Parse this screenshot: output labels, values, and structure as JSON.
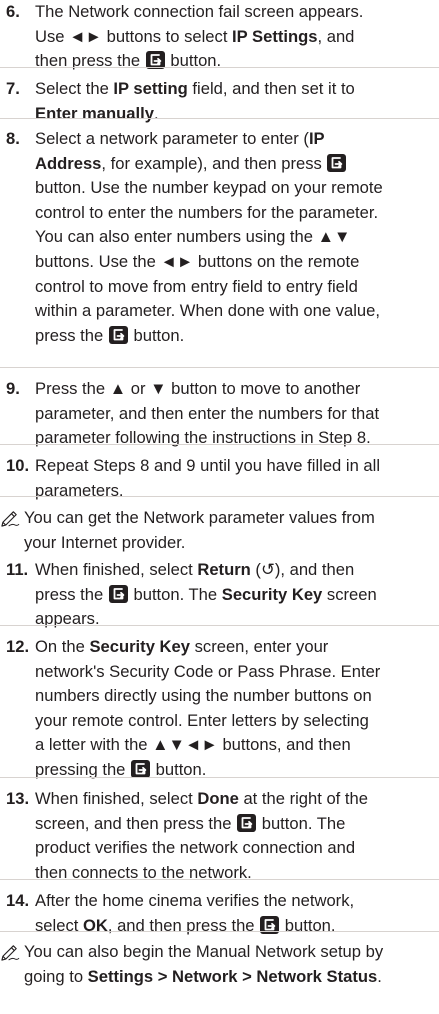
{
  "steps": [
    {
      "num": "6.",
      "lines": [
        [
          {
            "t": "The Network connection fail screen appears."
          }
        ],
        [
          {
            "t": "Use "
          },
          {
            "t": "◄►"
          },
          {
            "t": " buttons to select "
          },
          {
            "t": "IP Settings",
            "b": 1
          },
          {
            "t": ", and"
          }
        ],
        [
          {
            "t": "then press the "
          },
          {
            "i": "enter-icon"
          },
          {
            "t": " button."
          }
        ]
      ]
    },
    {
      "num": "7.",
      "lines": [
        [
          {
            "t": "Select the "
          },
          {
            "t": "IP setting",
            "b": 1
          },
          {
            "t": " field, and then set it to"
          }
        ],
        [
          {
            "t": "Enter manually",
            "b": 1
          },
          {
            "t": "."
          }
        ]
      ]
    },
    {
      "num": "8.",
      "lines": [
        [
          {
            "t": "Select a network parameter to enter ("
          },
          {
            "t": "IP",
            "b": 1
          }
        ],
        [
          {
            "t": "Address",
            "b": 1
          },
          {
            "t": ", for example), and then press "
          },
          {
            "i": "enter-icon"
          }
        ],
        [
          {
            "t": "button. Use the number keypad on your remote"
          }
        ],
        [
          {
            "t": "control to enter the numbers for the parameter."
          }
        ],
        [
          {
            "t": "You can also enter numbers using the ▲▼"
          }
        ],
        [
          {
            "t": "buttons. Use the ◄► buttons on the remote"
          }
        ],
        [
          {
            "t": "control to move from entry field to entry field"
          }
        ],
        [
          {
            "t": "within a parameter. When done with one value,"
          }
        ],
        [
          {
            "t": "press the "
          },
          {
            "i": "enter-icon"
          },
          {
            "t": " button."
          }
        ]
      ]
    },
    {
      "num": "9.",
      "lines": [
        [
          {
            "t": "Press the ▲ or ▼ button to move to another"
          }
        ],
        [
          {
            "t": "parameter, and then enter the numbers for that"
          }
        ],
        [
          {
            "t": "parameter following the instructions in Step 8."
          }
        ]
      ]
    },
    {
      "num": "10.",
      "lines": [
        [
          {
            "t": "Repeat Steps 8 and 9 until you have filled in all"
          }
        ],
        [
          {
            "t": "parameters."
          }
        ]
      ]
    },
    {
      "note": 1,
      "lines": [
        [
          {
            "t": "You can get the Network parameter values from"
          }
        ],
        [
          {
            "t": "your Internet provider."
          }
        ]
      ]
    },
    {
      "num": "11.",
      "lines": [
        [
          {
            "t": "When finished, select "
          },
          {
            "t": "Return",
            "b": 1
          },
          {
            "t": " (↺), and then"
          }
        ],
        [
          {
            "t": "press the "
          },
          {
            "i": "enter-icon"
          },
          {
            "t": " button. The "
          },
          {
            "t": "Security Key",
            "b": 1
          },
          {
            "t": " screen"
          }
        ],
        [
          {
            "t": "appears."
          }
        ]
      ]
    },
    {
      "num": "12.",
      "lines": [
        [
          {
            "t": "On the "
          },
          {
            "t": "Security Key",
            "b": 1
          },
          {
            "t": " screen, enter your"
          }
        ],
        [
          {
            "t": "network's Security Code or Pass Phrase. Enter"
          }
        ],
        [
          {
            "t": "numbers directly using the number buttons on"
          }
        ],
        [
          {
            "t": "your remote control. Enter letters by selecting"
          }
        ],
        [
          {
            "t": "a letter with the ▲▼◄► buttons, and then"
          }
        ],
        [
          {
            "t": "pressing the "
          },
          {
            "i": "enter-icon"
          },
          {
            "t": " button."
          }
        ]
      ]
    },
    {
      "num": "13.",
      "lines": [
        [
          {
            "t": "When finished, select "
          },
          {
            "t": "Done",
            "b": 1
          },
          {
            "t": " at the right of the"
          }
        ],
        [
          {
            "t": "screen, and then press the "
          },
          {
            "i": "enter-icon"
          },
          {
            "t": " button. The"
          }
        ],
        [
          {
            "t": "product verifies the network connection and"
          }
        ],
        [
          {
            "t": "then connects to the network."
          }
        ]
      ]
    },
    {
      "num": "14.",
      "lines": [
        [
          {
            "t": "After the home cinema verifies the network,"
          }
        ],
        [
          {
            "t": "select "
          },
          {
            "t": "OK",
            "b": 1
          },
          {
            "t": ", and then press the "
          },
          {
            "i": "enter-icon"
          },
          {
            "t": " button."
          }
        ]
      ]
    },
    {
      "note": 1,
      "lines": [
        [
          {
            "t": "You can also begin the Manual Network setup by"
          }
        ],
        [
          {
            "t": "going to "
          },
          {
            "t": "Settings > Network > Network Status",
            "b": 1
          },
          {
            "t": "."
          }
        ]
      ]
    }
  ]
}
